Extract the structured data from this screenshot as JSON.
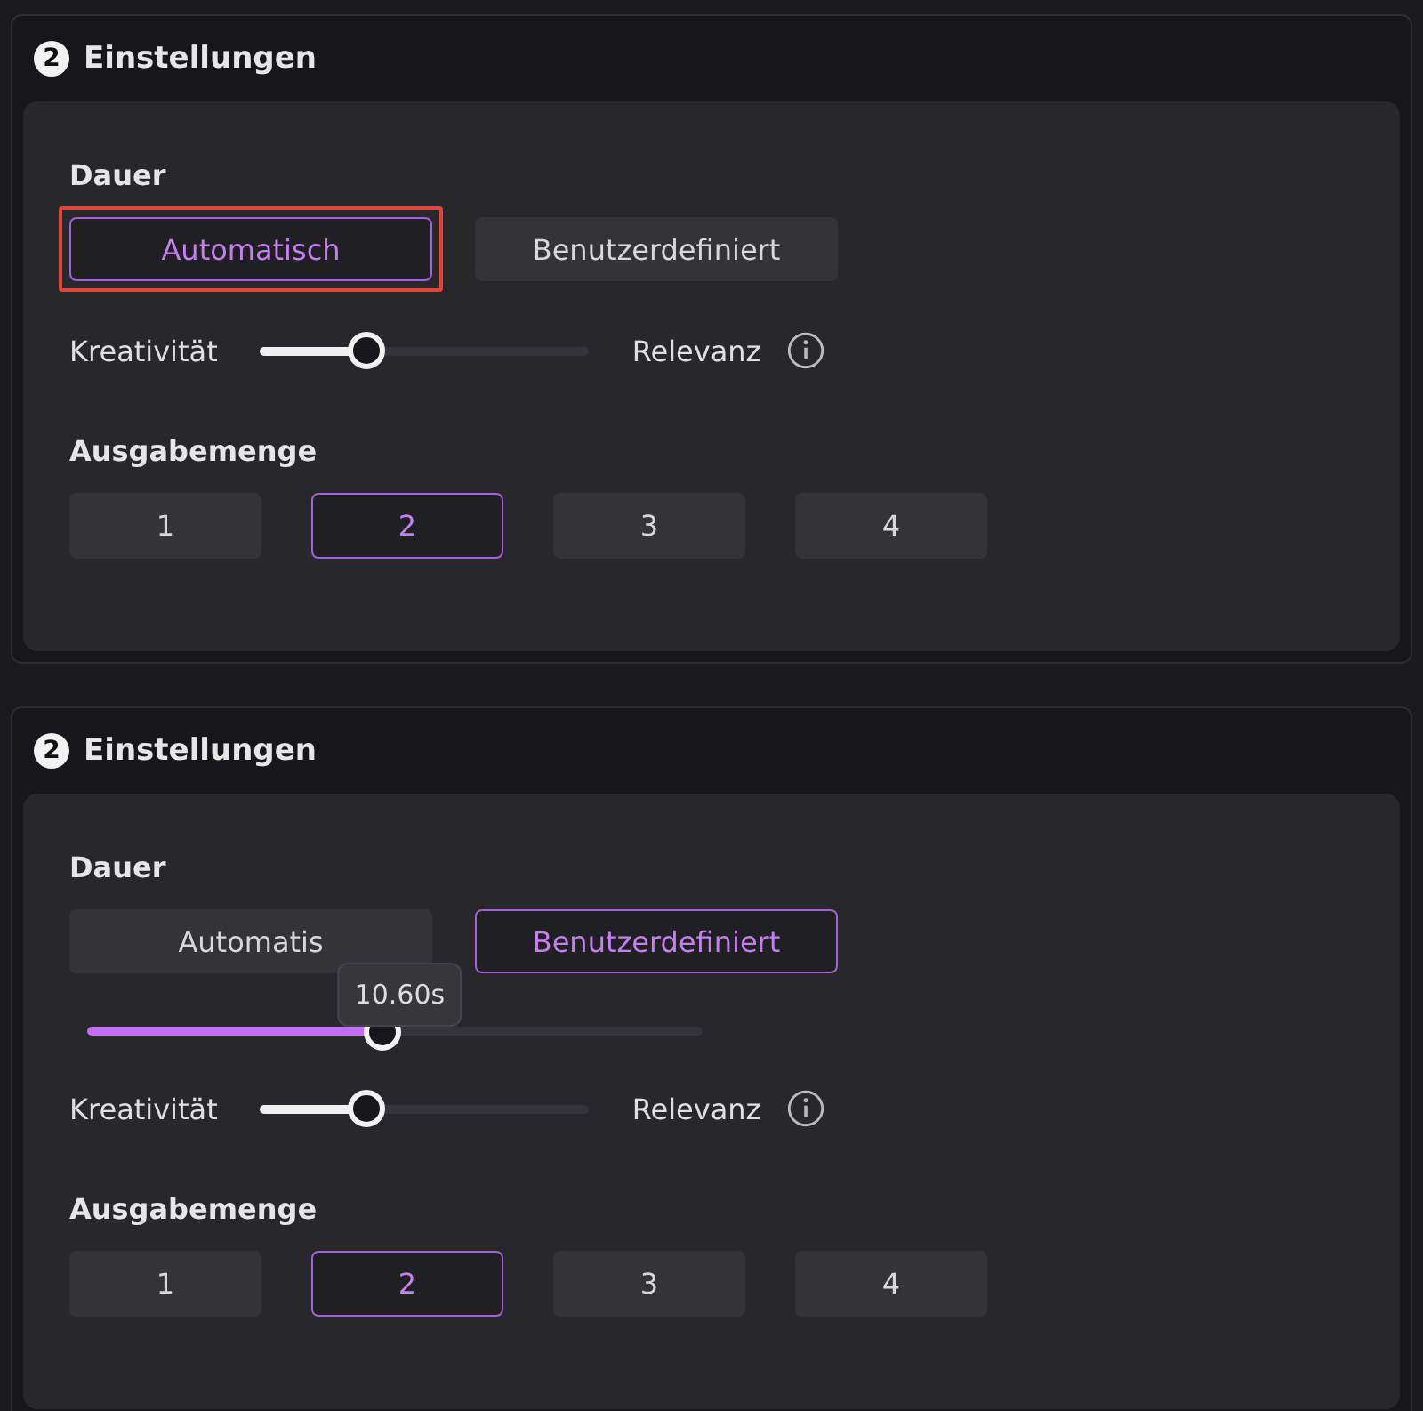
{
  "panels": [
    {
      "step": "2",
      "title": "Einstellungen",
      "duration": {
        "label": "Dauer",
        "options": [
          {
            "label": "Automatisch",
            "selected": true,
            "highlighted": true
          },
          {
            "label": "Benutzerdefiniert",
            "selected": false,
            "highlighted": false
          }
        ]
      },
      "creativity": {
        "left_label": "Kreativität",
        "right_label": "Relevanz",
        "level": 0.32
      },
      "output": {
        "label": "Ausgabemenge",
        "options": [
          {
            "label": "1",
            "selected": false
          },
          {
            "label": "2",
            "selected": true
          },
          {
            "label": "3",
            "selected": false
          },
          {
            "label": "4",
            "selected": false
          }
        ]
      }
    },
    {
      "step": "2",
      "title": "Einstellungen",
      "duration": {
        "label": "Dauer",
        "options": [
          {
            "label": "Automatis",
            "selected": false,
            "highlighted": false
          },
          {
            "label": "Benutzerdefiniert",
            "selected": true,
            "highlighted": false
          }
        ],
        "slider": {
          "level": 0.48,
          "reading": "10.60s"
        }
      },
      "creativity": {
        "left_label": "Kreativität",
        "right_label": "Relevanz",
        "level": 0.32
      },
      "output": {
        "label": "Ausgabemenge",
        "options": [
          {
            "label": "1",
            "selected": false
          },
          {
            "label": "2",
            "selected": true
          },
          {
            "label": "3",
            "selected": false
          },
          {
            "label": "4",
            "selected": false
          }
        ]
      }
    }
  ]
}
